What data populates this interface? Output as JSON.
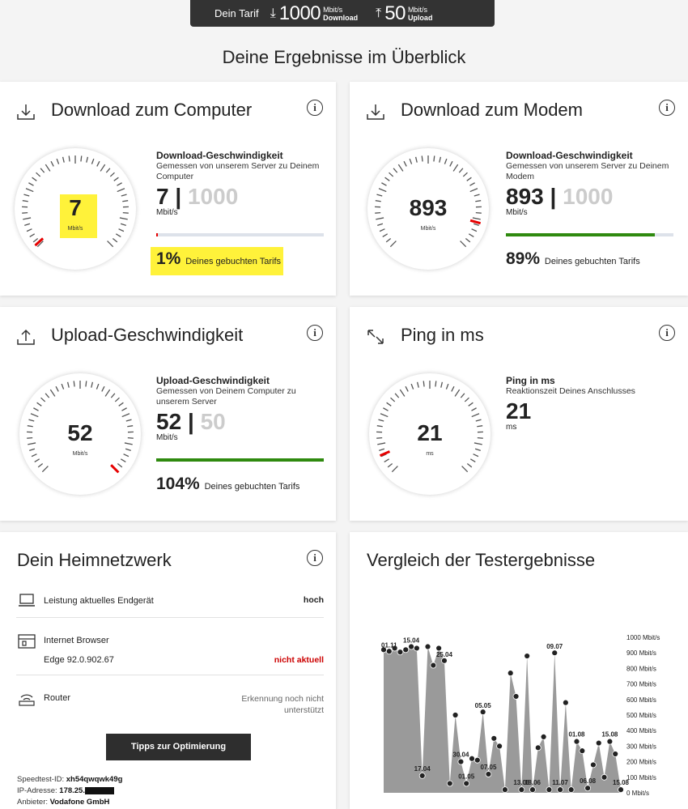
{
  "tarif": {
    "label": "Dein Tarif",
    "download_value": "1000",
    "download_unit": "Mbit/s",
    "download_label": "Download",
    "upload_value": "50",
    "upload_unit": "Mbit/s",
    "upload_label": "Upload"
  },
  "page_title": "Deine Ergebnisse im Überblick",
  "cards": {
    "download_computer": {
      "title": "Download zum Computer",
      "gauge_value": "7",
      "gauge_unit": "Mbit/s",
      "metric_title": "Download-Geschwindigkeit",
      "metric_sub": "Gemessen von unserem Server zu Deinem Computer",
      "value": "7",
      "separator": "|",
      "tariff": "1000",
      "unit": "Mbit/s",
      "percent": "1%",
      "percent_text": "Deines gebuchten Tarifs",
      "fill_fraction": 0.01
    },
    "download_modem": {
      "title": "Download zum Modem",
      "gauge_value": "893",
      "gauge_unit": "Mbit/s",
      "metric_title": "Download-Geschwindigkeit",
      "metric_sub": "Gemessen von unserem Server zu Deinem Modem",
      "value": "893",
      "separator": "|",
      "tariff": "1000",
      "unit": "Mbit/s",
      "percent": "89%",
      "percent_text": "Deines gebuchten Tarifs",
      "fill_fraction": 0.89
    },
    "upload": {
      "title": "Upload-Geschwindigkeit",
      "gauge_value": "52",
      "gauge_unit": "Mbit/s",
      "metric_title": "Upload-Geschwindigkeit",
      "metric_sub": "Gemessen von Deinem Computer zu unserem Server",
      "value": "52",
      "separator": "|",
      "tariff": "50",
      "unit": "Mbit/s",
      "percent": "104%",
      "percent_text": "Deines gebuchten Tarifs",
      "fill_fraction": 1.0
    },
    "ping": {
      "title": "Ping in ms",
      "gauge_value": "21",
      "gauge_unit": "ms",
      "metric_title": "Ping in ms",
      "metric_sub": "Reaktionszeit Deines Anschlusses",
      "value": "21",
      "unit": "ms"
    },
    "heimnetz": {
      "title": "Dein Heimnetzwerk",
      "rows": [
        {
          "label": "Leistung aktuelles Endgerät",
          "value": "hoch"
        },
        {
          "label": "Internet Browser",
          "sub": "Edge 92.0.902.67",
          "value": "nicht aktuell"
        },
        {
          "label": "Router",
          "value": "Erkennung noch nicht unterstützt"
        }
      ],
      "button": "Tipps zur Optimierung",
      "speedtest_label": "Speedtest-ID:",
      "speedtest_id": "xh54qwqwk49g",
      "ip_label": "IP-Adresse:",
      "ip_value": "178.25.",
      "provider_label": "Anbieter:",
      "provider": "Vodafone GmbH"
    },
    "vergleich": {
      "title": "Vergleich der Testergebnisse"
    }
  },
  "colors": {
    "needle": "#e60000",
    "green": "#2f8a0f",
    "red_text": "#cc0000",
    "highlight": "#fff23a",
    "area": "#9a9a9a"
  },
  "chart_data": {
    "type": "area",
    "ylabel": "",
    "ylim": [
      0,
      1000
    ],
    "yticks": [
      "1000 Mbit/s",
      "900 Mbit/s",
      "800 Mbit/s",
      "700 Mbit/s",
      "600 Mbit/s",
      "500 Mbit/s",
      "400 Mbit/s",
      "300 Mbit/s",
      "200 Mbit/s",
      "100 Mbit/s",
      "0 Mbit/s"
    ],
    "values": [
      920,
      910,
      930,
      905,
      920,
      940,
      930,
      110,
      940,
      820,
      930,
      850,
      60,
      500,
      200,
      60,
      220,
      210,
      520,
      120,
      350,
      300,
      20,
      770,
      620,
      20,
      880,
      20,
      290,
      360,
      20,
      900,
      20,
      580,
      20,
      330,
      270,
      30,
      180,
      320,
      100,
      330,
      250,
      20
    ],
    "date_labels": [
      {
        "i": 1,
        "text": "01.11"
      },
      {
        "i": 5,
        "text": "15.04"
      },
      {
        "i": 7,
        "text": "17.04"
      },
      {
        "i": 11,
        "text": "25.04"
      },
      {
        "i": 14,
        "text": "30.04"
      },
      {
        "i": 15,
        "text": "01.05"
      },
      {
        "i": 18,
        "text": "05.05"
      },
      {
        "i": 19,
        "text": "07.05"
      },
      {
        "i": 25,
        "text": "13.06"
      },
      {
        "i": 27,
        "text": "18.06"
      },
      {
        "i": 31,
        "text": "09.07"
      },
      {
        "i": 32,
        "text": "11.07"
      },
      {
        "i": 35,
        "text": "01.08"
      },
      {
        "i": 37,
        "text": "06.08"
      },
      {
        "i": 41,
        "text": "15.08"
      },
      {
        "i": 43,
        "text": "15.08"
      }
    ]
  }
}
